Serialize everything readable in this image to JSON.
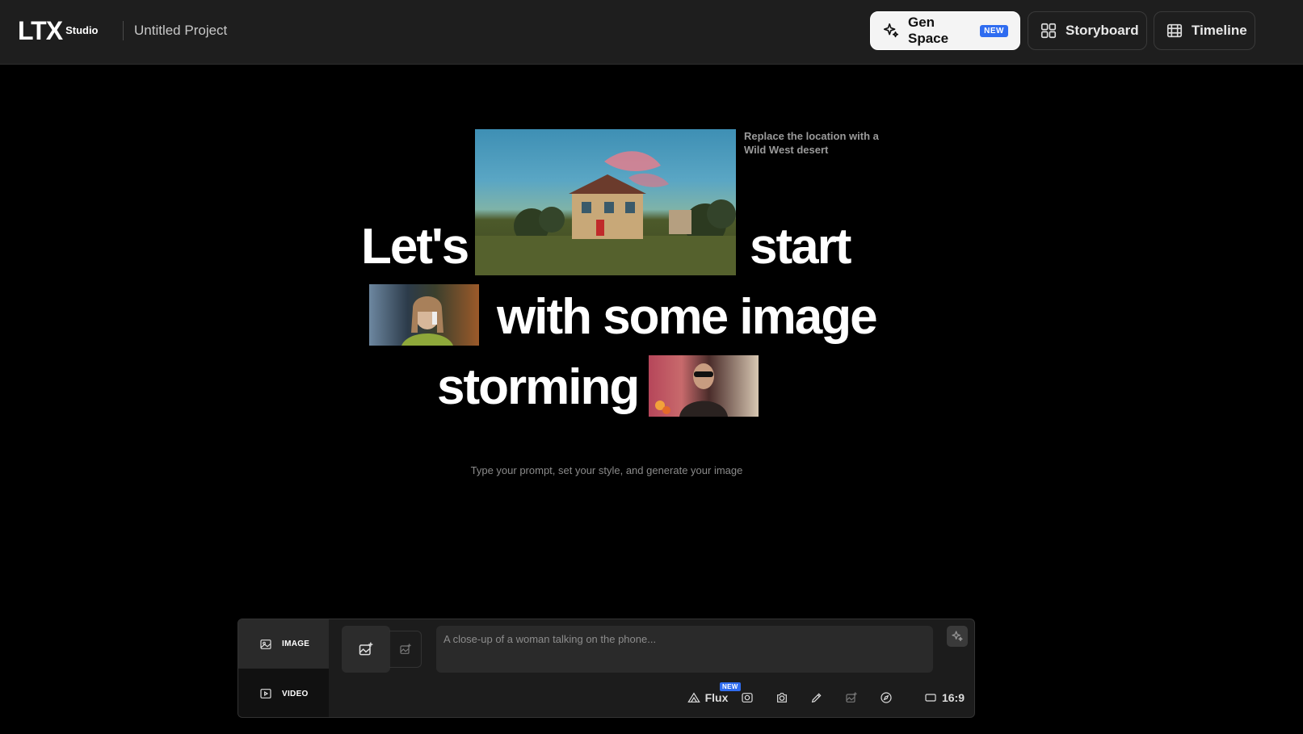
{
  "header": {
    "logo_mark": "LTX",
    "logo_sub": "Studio",
    "project_title": "Untitled Project",
    "nav": [
      {
        "label": "Gen Space",
        "badge": "NEW",
        "icon": "sparkle-icon",
        "active": true
      },
      {
        "label": "Storyboard",
        "icon": "grid-icon",
        "active": false
      },
      {
        "label": "Timeline",
        "icon": "film-icon",
        "active": false
      }
    ]
  },
  "hero": {
    "words": [
      "Let's",
      "start",
      "with some image",
      "storming"
    ],
    "thumb_caption": "Replace the location with a Wild West desert",
    "subline": "Type your prompt, set your style, and generate your image"
  },
  "prompt_panel": {
    "modes": [
      {
        "label": "IMAGE",
        "icon": "image-icon",
        "active": true
      },
      {
        "label": "VIDEO",
        "icon": "play-icon",
        "active": false
      }
    ],
    "placeholder": "A close-up of a woman talking on the phone...",
    "model": {
      "label": "Flux",
      "badge": "NEW"
    },
    "aspect_ratio": "16:9"
  },
  "colors": {
    "topbar_bg": "#1e1e1e",
    "accent_blue": "#2f6cf0",
    "panel_bg": "#1c1c1c"
  }
}
